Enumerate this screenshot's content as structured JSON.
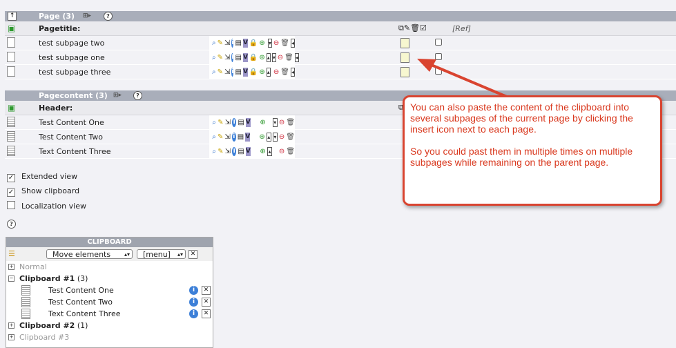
{
  "page_section": {
    "title": "Page (3)",
    "column_title": "Pagetitle:",
    "ref_label": "[Ref]",
    "rows": [
      {
        "title": "test subpage two"
      },
      {
        "title": "test subpage one"
      },
      {
        "title": "test subpage three"
      }
    ]
  },
  "content_section": {
    "title": "Pagecontent (3)",
    "column_title": "Header:",
    "rows": [
      {
        "title": "Test Content One"
      },
      {
        "title": "Test Content Two"
      },
      {
        "title": "Text Content Three"
      }
    ]
  },
  "options": {
    "extended_view": {
      "label": "Extended view",
      "checked": true
    },
    "show_clipboard": {
      "label": "Show clipboard",
      "checked": true
    },
    "localization_view": {
      "label": "Localization view",
      "checked": false
    }
  },
  "clipboard": {
    "title": "CLIPBOARD",
    "mode_select": "Move elements",
    "menu_select": "[menu]",
    "groups": {
      "normal": {
        "label": "Normal"
      },
      "clip1": {
        "label": "Clipboard #1",
        "count": "(3)",
        "items": [
          "Test Content One",
          "Test Content Two",
          "Text Content Three"
        ]
      },
      "clip2": {
        "label": "Clipboard #2",
        "count": "(1)"
      },
      "clip3": {
        "label": "Clipboard #3"
      }
    }
  },
  "callout": {
    "line1": "You can also paste the content of the clipboard into several subpages of the current page by clicking the insert icon next to each page.",
    "line2": "So you could past them in multiple times on multiple subpages while remaining on the parent page.",
    "color": "#d9381e"
  }
}
